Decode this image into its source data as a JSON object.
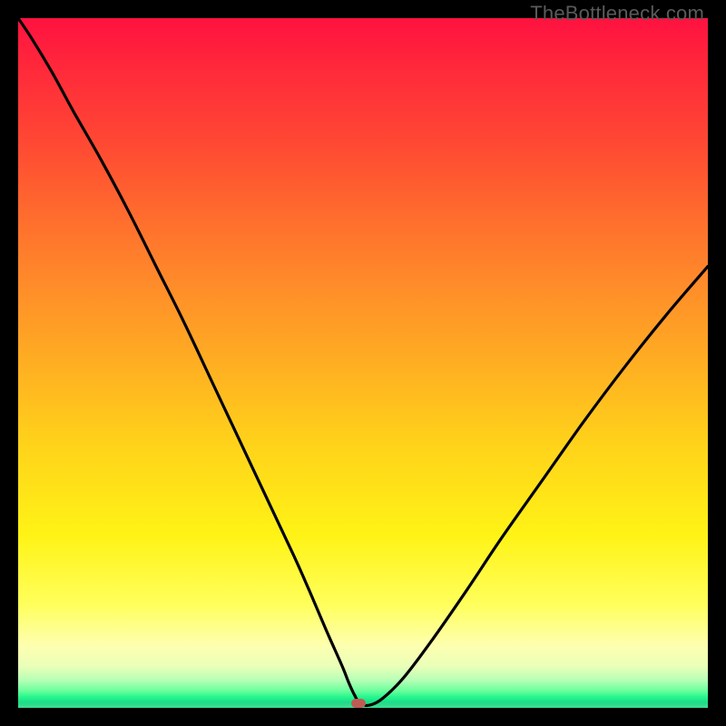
{
  "watermark": "TheBottleneck.com",
  "colors": {
    "curve_stroke": "#000000",
    "marker_fill": "#c05a55"
  },
  "chart_data": {
    "type": "line",
    "title": "",
    "xlabel": "",
    "ylabel": "",
    "xlim": [
      0,
      100
    ],
    "ylim": [
      0,
      100
    ],
    "grid": false,
    "legend": false,
    "x": [
      0,
      2,
      5,
      8,
      12,
      16,
      20,
      24,
      28,
      32,
      36,
      40,
      42,
      43.5,
      45,
      47,
      48,
      48.8,
      49.6,
      51,
      53,
      56,
      60,
      65,
      70,
      76,
      82,
      88,
      94,
      100
    ],
    "values": [
      100,
      97,
      92,
      86.5,
      79.5,
      72,
      64,
      56,
      47.5,
      39,
      30.5,
      22,
      17.5,
      14,
      10.5,
      6,
      3.5,
      1.8,
      0.6,
      0.4,
      1.5,
      4.5,
      9.8,
      17,
      24.5,
      33,
      41.5,
      49.5,
      57,
      64
    ],
    "marker": {
      "x": 49.3,
      "y": 0.7
    },
    "notes": "V-shaped bottleneck curve on a red→green vertical gradient. Values are visual estimates (percent of plot height/width); the image has no numeric axes."
  }
}
